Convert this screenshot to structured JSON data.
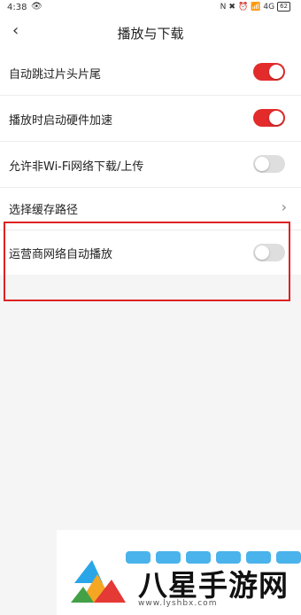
{
  "status_bar": {
    "time": "4:38",
    "eye_glyph": "👁",
    "right_icons": [
      "N",
      "✖",
      "⏰",
      "📶",
      "4G"
    ],
    "battery": "62"
  },
  "header": {
    "back_glyph": "‹",
    "title": "播放与下载"
  },
  "settings": [
    {
      "label": "自动跳过片头片尾",
      "control": "toggle",
      "state": "on"
    },
    {
      "label": "播放时启动硬件加速",
      "control": "toggle",
      "state": "on"
    },
    {
      "label": "允许非Wi-Fi网络下载/上传",
      "control": "toggle",
      "state": "off"
    },
    {
      "label": "选择缓存路径",
      "control": "chevron",
      "glyph": "›"
    },
    {
      "label": "运营商网络自动播放",
      "control": "toggle",
      "state": "off"
    }
  ],
  "colors": {
    "toggle_on": "#e32b2b",
    "toggle_off": "#dedede",
    "highlight_border": "#d22"
  },
  "watermark": {
    "title": "八星手游网",
    "url": "www.lyshbx.com"
  }
}
